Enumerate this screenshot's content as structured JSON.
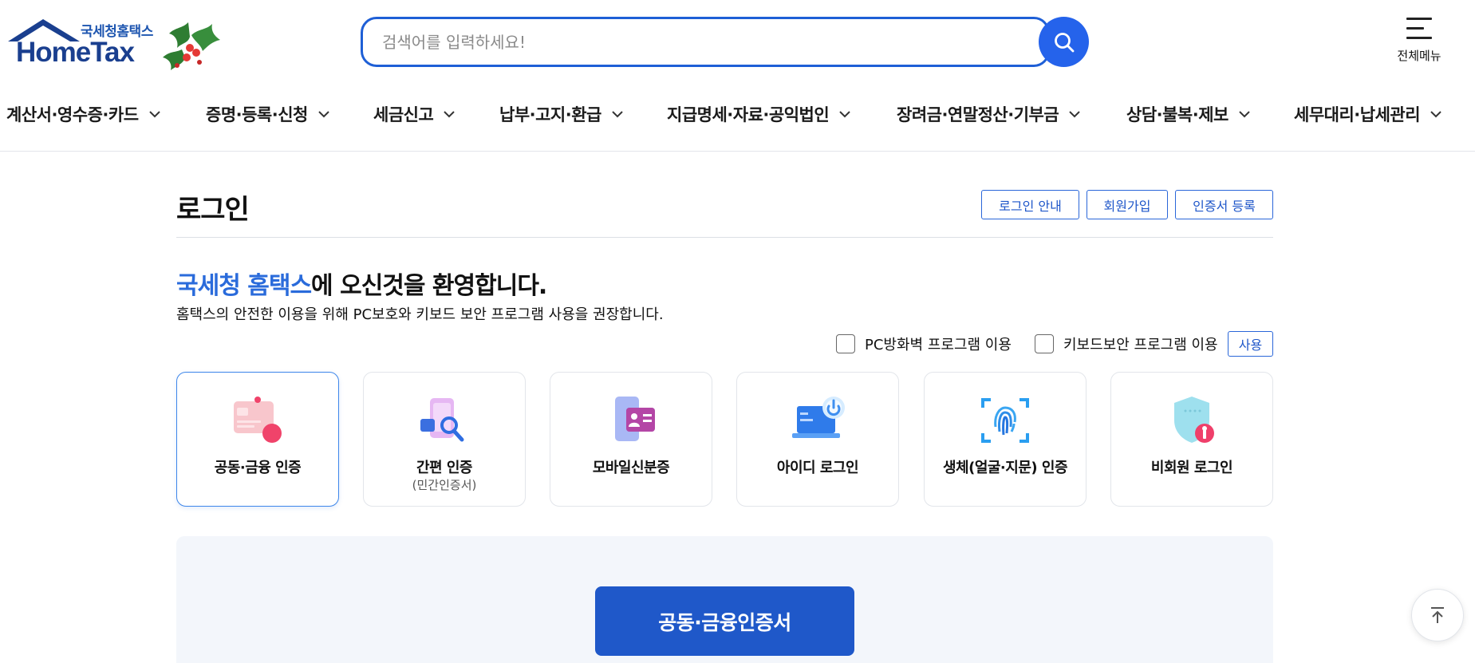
{
  "header": {
    "logo_sub": "국세청홈택스",
    "logo_main": "HomeTax",
    "search_placeholder": "검색어를 입력하세요!",
    "all_menu_label": "전체메뉴"
  },
  "nav": {
    "items": [
      {
        "label": "계산서·영수증·카드"
      },
      {
        "label": "증명·등록·신청"
      },
      {
        "label": "세금신고"
      },
      {
        "label": "납부·고지·환급"
      },
      {
        "label": "지급명세·자료·공익법인"
      },
      {
        "label": "장려금·연말정산·기부금"
      },
      {
        "label": "상담·불복·제보"
      },
      {
        "label": "세무대리·납세관리"
      }
    ]
  },
  "page": {
    "title": "로그인",
    "buttons": {
      "login_guide": "로그인 안내",
      "signup": "회원가입",
      "cert_register": "인증서 등록"
    }
  },
  "welcome": {
    "accent": "국세청 홈택스",
    "rest": "에 오신것을 환영합니다.",
    "desc": "홈택스의 안전한 이용을 위해 PC보호와 키보드 보안 프로그램 사용을 권장합니다."
  },
  "security": {
    "firewall_label": "PC방화벽 프로그램 이용",
    "keyboard_label": "키보드보안 프로그램 이용",
    "use_label": "사용"
  },
  "login_methods": [
    {
      "label": "공동·금융 인증",
      "sub": "",
      "icon": "joint-cert-card-icon",
      "active": true
    },
    {
      "label": "간편 인증",
      "sub": "(민간인증서)",
      "icon": "simple-auth-phone-icon",
      "active": false
    },
    {
      "label": "모바일신분증",
      "sub": "",
      "icon": "mobile-id-icon",
      "active": false
    },
    {
      "label": "아이디 로그인",
      "sub": "",
      "icon": "id-login-laptop-icon",
      "active": false
    },
    {
      "label": "생체(얼굴·지문) 인증",
      "sub": "",
      "icon": "fingerprint-icon",
      "active": false
    },
    {
      "label": "비회원 로그인",
      "sub": "",
      "icon": "guest-shield-icon",
      "active": false
    }
  ],
  "panel": {
    "cert_button": "공동·금융인증서"
  },
  "colors": {
    "accent_blue": "#2563eb",
    "brand_navy": "#1a3f8f",
    "primary_button": "#1f58c9",
    "panel_bg": "#f3f6fb"
  }
}
